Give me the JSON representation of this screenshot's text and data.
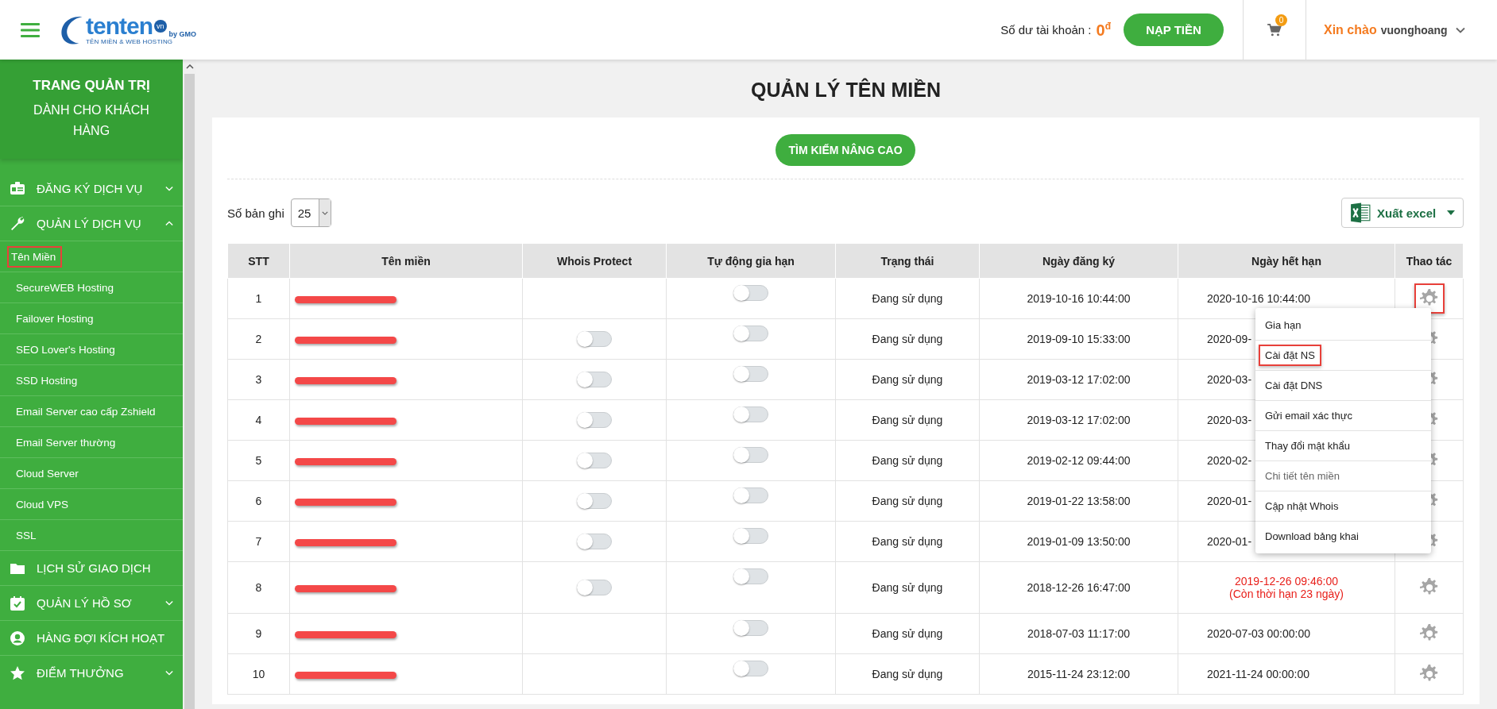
{
  "header": {
    "logo": {
      "name": "tenten",
      "badge": "vn",
      "by": "by GMO",
      "tagline": "TÊN MIỀN & WEB HOSTING"
    },
    "balance_label": "Số dư tài khoản :",
    "balance_value": "0",
    "balance_currency": "đ",
    "topup_button": "NẠP TIỀN",
    "cart_count": "0",
    "greeting": "Xin chào",
    "username": "vuonghoang"
  },
  "sidebar": {
    "title": "TRANG QUẢN TRỊ",
    "subtitle": "DÀNH CHO KHÁCH HÀNG",
    "items": [
      {
        "label": "ĐĂNG KÝ DỊCH VỤ",
        "expanded": false
      },
      {
        "label": "QUẢN LÝ DỊCH VỤ",
        "expanded": true,
        "children": [
          {
            "label": "Tên Miền",
            "selected": true
          },
          {
            "label": "SecureWEB Hosting",
            "selected": false
          },
          {
            "label": "Failover Hosting",
            "selected": false
          },
          {
            "label": "SEO Lover's Hosting",
            "selected": false
          },
          {
            "label": "SSD Hosting",
            "selected": false
          },
          {
            "label": "Email Server cao cấp Zshield",
            "selected": false
          },
          {
            "label": "Email Server thường",
            "selected": false
          },
          {
            "label": "Cloud Server",
            "selected": false
          },
          {
            "label": "Cloud VPS",
            "selected": false
          },
          {
            "label": "SSL",
            "selected": false
          }
        ]
      },
      {
        "label": "LỊCH SỬ GIAO DỊCH"
      },
      {
        "label": "QUẢN LÝ HỒ SƠ",
        "expanded": false
      },
      {
        "label": "HÀNG ĐỢI KÍCH HOẠT"
      },
      {
        "label": "ĐIỂM THƯỞNG",
        "expanded": false
      }
    ]
  },
  "page_title": "QUẢN LÝ TÊN MIỀN",
  "search_button": "TÌM KIẾM NÂNG CAO",
  "records_label": "Số bản ghi",
  "records_value": "25",
  "export_button": "Xuất excel",
  "table": {
    "columns": [
      "STT",
      "Tên miền",
      "Whois Protect",
      "Tự động gia hạn",
      "Trạng thái",
      "Ngày đăng ký",
      "Ngày hết hạn",
      "Thao tác"
    ],
    "rows": [
      {
        "stt": "1",
        "domain_redacted": true,
        "auto_renew": false,
        "status": "Đang sử dụng",
        "registered": "2019-10-16 10:44:00",
        "expires": "2020-10-16 10:44:00",
        "expiry_warning": false,
        "action_highlighted": true
      },
      {
        "stt": "2",
        "domain_redacted": true,
        "whois_protect": false,
        "auto_renew": false,
        "status": "Đang sử dụng",
        "registered": "2019-09-10 15:33:00",
        "expires": "2020-09-",
        "expiry_warning": false,
        "action_highlighted": false
      },
      {
        "stt": "3",
        "domain_redacted": true,
        "whois_protect": false,
        "auto_renew": false,
        "status": "Đang sử dụng",
        "registered": "2019-03-12 17:02:00",
        "expires": "2020-03-",
        "expiry_warning": false,
        "action_highlighted": false
      },
      {
        "stt": "4",
        "domain_redacted": true,
        "whois_protect": false,
        "auto_renew": false,
        "status": "Đang sử dụng",
        "registered": "2019-03-12 17:02:00",
        "expires": "2020-03-",
        "expiry_warning": false,
        "action_highlighted": false
      },
      {
        "stt": "5",
        "domain_redacted": true,
        "whois_protect": false,
        "auto_renew": false,
        "status": "Đang sử dụng",
        "registered": "2019-02-12 09:44:00",
        "expires": "2020-02-",
        "expiry_warning": false,
        "action_highlighted": false
      },
      {
        "stt": "6",
        "domain_redacted": true,
        "whois_protect": false,
        "auto_renew": false,
        "status": "Đang sử dụng",
        "registered": "2019-01-22 13:58:00",
        "expires": "2020-01-",
        "expiry_warning": false,
        "action_highlighted": false
      },
      {
        "stt": "7",
        "domain_redacted": true,
        "whois_protect": false,
        "auto_renew": false,
        "status": "Đang sử dụng",
        "registered": "2019-01-09 13:50:00",
        "expires": "2020-01-",
        "expiry_warning": false,
        "action_highlighted": false
      },
      {
        "stt": "8",
        "domain_redacted": true,
        "whois_protect": false,
        "auto_renew": false,
        "status": "Đang sử dụng",
        "registered": "2018-12-26 16:47:00",
        "expires": "2019-12-26 09:46:00",
        "expiry_note": "(Còn thời hạn 23 ngày)",
        "expiry_warning": true,
        "action_highlighted": false
      },
      {
        "stt": "9",
        "domain_redacted": true,
        "auto_renew": false,
        "status": "Đang sử dụng",
        "registered": "2018-07-03 11:17:00",
        "expires": "2020-07-03 00:00:00",
        "expiry_warning": false,
        "action_highlighted": false
      },
      {
        "stt": "10",
        "domain_redacted": true,
        "auto_renew": false,
        "status": "Đang sử dụng",
        "registered": "2015-11-24 23:12:00",
        "expires": "2021-11-24 00:00:00",
        "expiry_warning": false,
        "action_highlighted": false
      }
    ]
  },
  "action_menu": [
    {
      "label": "Gia hạn",
      "highlighted": false,
      "disabled": false
    },
    {
      "label": "Cài đặt NS",
      "highlighted": true,
      "disabled": false
    },
    {
      "label": "Cài đặt DNS",
      "highlighted": false,
      "disabled": false
    },
    {
      "label": "Gửi email xác thực",
      "highlighted": false,
      "disabled": false
    },
    {
      "label": "Thay đổi mật khẩu",
      "highlighted": false,
      "disabled": false
    },
    {
      "label": "Chi tiết tên miền",
      "highlighted": false,
      "disabled": true
    },
    {
      "label": "Cập nhật Whois",
      "highlighted": false,
      "disabled": false
    },
    {
      "label": "Download bảng khai",
      "highlighted": false,
      "disabled": false
    }
  ]
}
